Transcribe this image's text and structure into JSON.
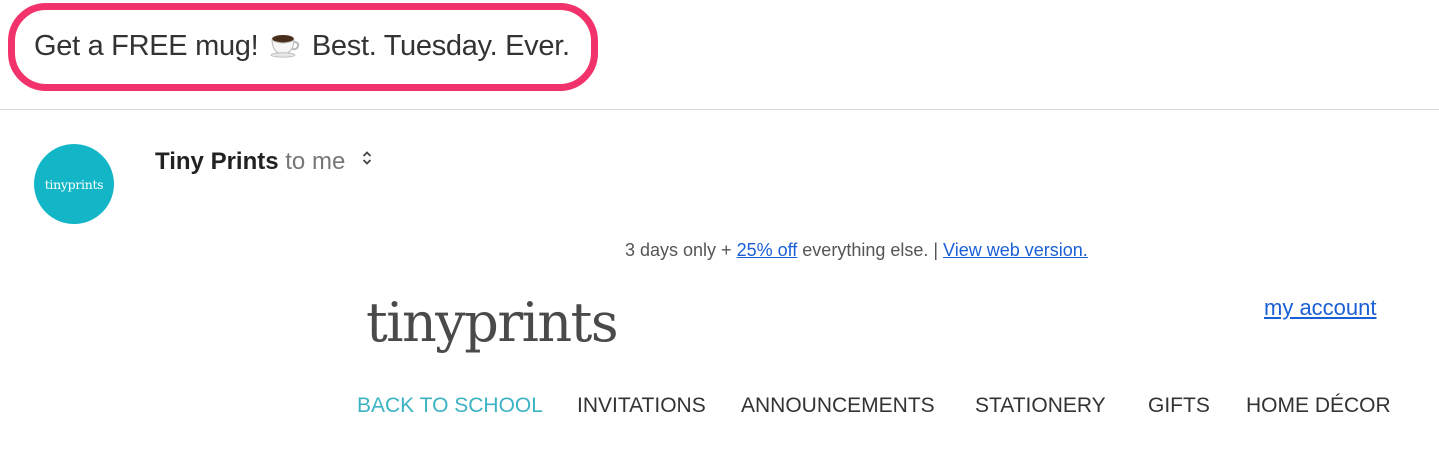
{
  "subject": {
    "before_icon": "Get a FREE mug!",
    "icon": "coffee-cup",
    "after_icon": "Best. Tuesday. Ever."
  },
  "sender": {
    "avatar_text": "tinyprints",
    "name": "Tiny Prints",
    "recipient": "to me"
  },
  "preheader": {
    "text_start": "3 days only + ",
    "discount_link": "25% off",
    "text_middle": " everything else. | ",
    "web_version_link": "View web version."
  },
  "email": {
    "logo_text": "tinyprints",
    "account_link": "my account",
    "nav": [
      {
        "label": "BACK TO SCHOOL",
        "active": true
      },
      {
        "label": "INVITATIONS",
        "active": false
      },
      {
        "label": "ANNOUNCEMENTS",
        "active": false
      },
      {
        "label": "STATIONERY",
        "active": false
      },
      {
        "label": "GIFTS",
        "active": false
      },
      {
        "label": "HOME DÉCOR",
        "active": false
      }
    ]
  },
  "colors": {
    "highlight_border": "#f2336b",
    "avatar_bg": "#13b6c6",
    "link": "#1a5fd6",
    "nav_active": "#3bb3c3"
  }
}
